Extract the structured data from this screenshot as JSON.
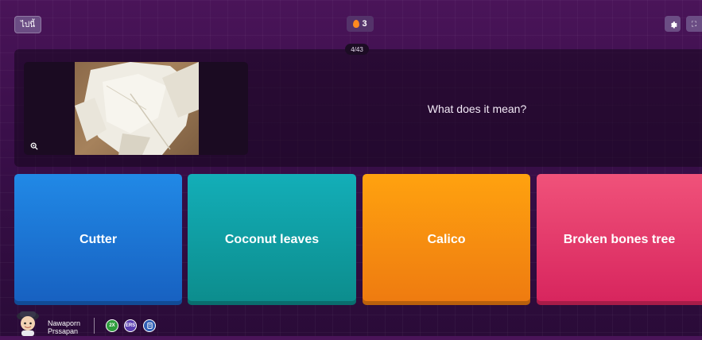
{
  "topbar": {
    "exit_label": "ไปนี้",
    "streak_count": "3",
    "progress": "4/43"
  },
  "question": {
    "text": "What does it mean?",
    "media": "fabric-photo"
  },
  "options": [
    {
      "label": "Cutter",
      "color": "#1f7fe0"
    },
    {
      "label": "Coconut leaves",
      "color": "#12a5ad"
    },
    {
      "label": "Calico",
      "color": "#fb9810"
    },
    {
      "label": "Broken bones tree",
      "color": "#e83e6c"
    }
  ],
  "player": {
    "first_name": "Nawaporn",
    "last_name": "Prssapan"
  },
  "powerups": [
    {
      "label": "2X",
      "color": "#2e9d3d",
      "icon": "double-points-icon"
    },
    {
      "label": "ERS",
      "color": "#5b3fb0",
      "icon": "eraser-icon"
    },
    {
      "label": "",
      "color": "#2f5fb5",
      "icon": "streak-saver-icon"
    }
  ],
  "colors": {
    "background": "#3a0f4a",
    "panel": "#1c0c24"
  }
}
